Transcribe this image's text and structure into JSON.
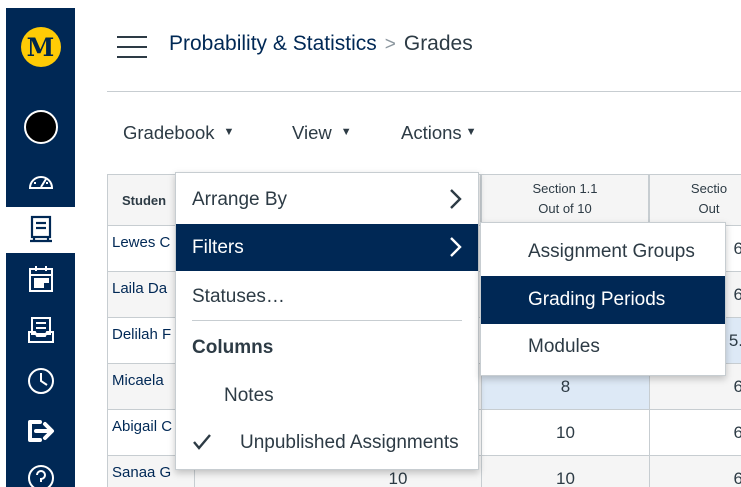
{
  "nav": {
    "logo_letter": "M",
    "items": [
      {
        "icon": "dashboard-icon"
      },
      {
        "icon": "courses-icon",
        "active": true
      },
      {
        "icon": "calendar-icon"
      },
      {
        "icon": "inbox-icon"
      },
      {
        "icon": "history-icon"
      },
      {
        "icon": "logout-icon"
      },
      {
        "icon": "help-icon"
      }
    ],
    "accent_color": "#002855",
    "logo_color": "#ffcb05"
  },
  "header": {
    "course": "Probability & Statistics",
    "separator": ">",
    "page": "Grades"
  },
  "toolbar": {
    "gradebook": "Gradebook",
    "view": "View",
    "actions": "Actions",
    "caret": "▼"
  },
  "grid": {
    "columns": [
      {
        "label": "Studen",
        "sub": ""
      },
      {
        "label": "Section 1.1",
        "sub": "Out of 10"
      },
      {
        "label": "Sectio",
        "sub": "Out"
      }
    ],
    "rows": [
      {
        "name": "Lewes C",
        "score1": "",
        "score2": "6"
      },
      {
        "name": "Laila Da",
        "score1": "",
        "score2": "6"
      },
      {
        "name": "Delilah F",
        "score1": "",
        "score2": "5."
      },
      {
        "name": "Micaela",
        "score1": "8",
        "score2": "6"
      },
      {
        "name": "Abigail C",
        "score1": "10",
        "score2": "6"
      },
      {
        "name": "Sanaa G",
        "score1": "10",
        "score2": "6"
      }
    ],
    "hidden_under_menu": [
      "10"
    ]
  },
  "view_menu": {
    "arrange_by": "Arrange By",
    "filters": "Filters",
    "statuses": "Statuses…",
    "columns_heading": "Columns",
    "notes": "Notes",
    "unpublished": "Unpublished Assignments",
    "check": "✓"
  },
  "filters_menu": {
    "items": [
      "Assignment Groups",
      "Grading Periods",
      "Modules"
    ],
    "selected": "Grading Periods"
  }
}
